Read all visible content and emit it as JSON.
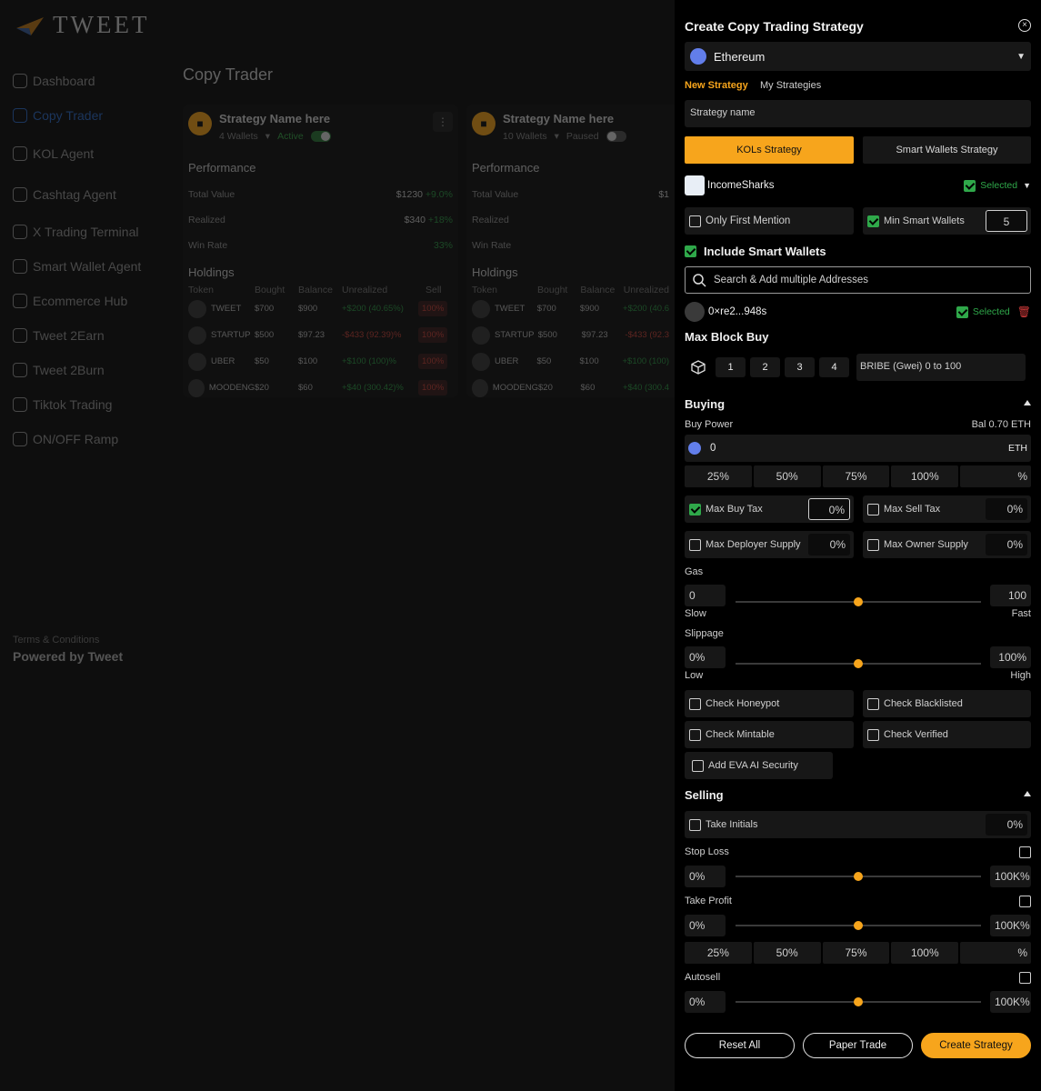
{
  "app": {
    "brand": "TWEET",
    "page_title": "Copy Trader"
  },
  "sidebar": {
    "items": [
      {
        "label": "Dashboard",
        "icon": "grid-icon"
      },
      {
        "label": "Copy Trader",
        "icon": "users-icon",
        "active": true
      },
      {
        "label": "KOL Agent",
        "icon": "agent-icon"
      },
      {
        "label": "Cashtag Agent",
        "icon": "dollar-icon"
      },
      {
        "label": "X Trading Terminal",
        "icon": "terminal-icon"
      },
      {
        "label": "Smart Wallet Agent",
        "icon": "bulb-icon"
      },
      {
        "label": "Ecommerce Hub",
        "icon": "shop-icon"
      },
      {
        "label": "Tweet 2Earn",
        "icon": "chart-icon"
      },
      {
        "label": "Tweet 2Burn",
        "icon": "flame-icon"
      },
      {
        "label": "Tiktok Trading",
        "icon": "handshake-icon"
      },
      {
        "label": "ON/OFF Ramp",
        "icon": "ramp-icon"
      }
    ],
    "terms": "Terms & Conditions",
    "powered": "Powered by Tweet"
  },
  "cards": [
    {
      "name": "Strategy Name here",
      "wallets": "4 Wallets",
      "status": "Active",
      "performance_title": "Performance",
      "total_value_label": "Total Value",
      "total_value": "$1230",
      "total_change": "+9.0%",
      "realized_label": "Realized",
      "realized": "$340",
      "realized_change": "+18%",
      "win_rate_label": "Win Rate",
      "win_rate": "33%",
      "holdings_title": "Holdings",
      "columns": [
        "Token",
        "Bought",
        "Balance",
        "Unrealized",
        "Sell"
      ],
      "rows": [
        {
          "token": "TWEET",
          "bought": "$700",
          "balance": "$900",
          "unrealized": "+$200 (40.65%)",
          "sell": "100%"
        },
        {
          "token": "STARTUP",
          "bought": "$500",
          "balance": "$97.23",
          "unrealized": "-$433 (92.39)%",
          "sell": "100%"
        },
        {
          "token": "UBER",
          "bought": "$50",
          "balance": "$100",
          "unrealized": "+$100 (100)%",
          "sell": "100%"
        },
        {
          "token": "MOODENG",
          "bought": "$20",
          "balance": "$60",
          "unrealized": "+$40 (300.42)%",
          "sell": "100%"
        }
      ]
    },
    {
      "name": "Strategy Name here",
      "wallets": "10 Wallets",
      "status": "Paused",
      "performance_title": "Performance",
      "total_value_label": "Total Value",
      "total_value": "$1",
      "total_change": "",
      "realized_label": "Realized",
      "realized": "",
      "realized_change": "",
      "win_rate_label": "Win Rate",
      "win_rate": "",
      "holdings_title": "Holdings",
      "columns": [
        "Token",
        "Bought",
        "Balance",
        "Unrealized"
      ],
      "rows": [
        {
          "token": "TWEET",
          "bought": "$700",
          "balance": "$900",
          "unrealized": "+$200 (40.6"
        },
        {
          "token": "STARTUP",
          "bought": "$500",
          "balance": "$97.23",
          "unrealized": "-$433 (92.3"
        },
        {
          "token": "UBER",
          "bought": "$50",
          "balance": "$100",
          "unrealized": "+$100 (100)"
        },
        {
          "token": "MOODENG",
          "bought": "$20",
          "balance": "$60",
          "unrealized": "+$40 (300.4"
        }
      ]
    }
  ],
  "drawer": {
    "title": "Create Copy Trading Strategy",
    "chain": "Ethereum",
    "tabs": [
      "New Strategy",
      "My Strategies"
    ],
    "strategy_name_placeholder": "Strategy name",
    "kol_button": "KOLs Strategy",
    "smart_button": "Smart Wallets Strategy",
    "kol_name": "IncomeSharks",
    "selected_label": "Selected",
    "only_first_mention": "Only First Mention",
    "min_smart_wallets": "Min Smart Wallets",
    "min_smart_wallets_value": "5",
    "include_smart_wallets": "Include Smart Wallets",
    "search_placeholder": "Search & Add multiple Addresses",
    "wallet_address": "0×re2...948s",
    "max_block_buy": "Max Block Buy",
    "block_options": [
      "1",
      "2",
      "3",
      "4"
    ],
    "bribe_placeholder": "BRIBE (Gwei) 0 to 100",
    "buying": "Buying",
    "buy_power": "Buy Power",
    "balance": "Bal 0.70 ETH",
    "buy_amount": "0",
    "currency": "ETH",
    "pct_options": [
      "25%",
      "50%",
      "75%",
      "100%",
      "%"
    ],
    "max_buy_tax": "Max Buy Tax",
    "max_buy_tax_value": "0%",
    "max_sell_tax": "Max Sell Tax",
    "max_sell_tax_value": "0%",
    "max_deployer_supply": "Max Deployer Supply",
    "max_deployer_supply_value": "0%",
    "max_owner_supply": "Max Owner Supply",
    "max_owner_supply_value": "0%",
    "gas": {
      "label": "Gas",
      "min": "0",
      "max": "100",
      "low": "Slow",
      "high": "Fast",
      "level": 0.5
    },
    "slippage": {
      "label": "Slippage",
      "min": "0%",
      "max": "100%",
      "low": "Low",
      "high": "High",
      "level": 0.5
    },
    "check_honeypot": "Check Honeypot",
    "check_blacklisted": "Check Blacklisted",
    "check_mintable": "Check Mintable",
    "check_verified": "Check Verified",
    "add_eva": "Add EVA AI Security",
    "selling": "Selling",
    "take_initials": "Take Initials",
    "take_initials_value": "0%",
    "stop_loss": {
      "label": "Stop Loss",
      "min": "0%",
      "max": "100K%",
      "level": 0.5
    },
    "take_profit": {
      "label": "Take Profit",
      "min": "0%",
      "max": "100K%",
      "level": 0.5
    },
    "autosell": {
      "label": "Autosell",
      "min": "0%",
      "max": "100K%",
      "level": 0.5
    },
    "reset_all": "Reset All",
    "paper_trade": "Paper Trade",
    "create_strategy": "Create Strategy"
  },
  "colors": {
    "accent": "#f7a51c",
    "check": "#2fa84a",
    "active_nav": "#2f6cc8",
    "loss": "#c8443a",
    "gain": "#2f9a47"
  }
}
